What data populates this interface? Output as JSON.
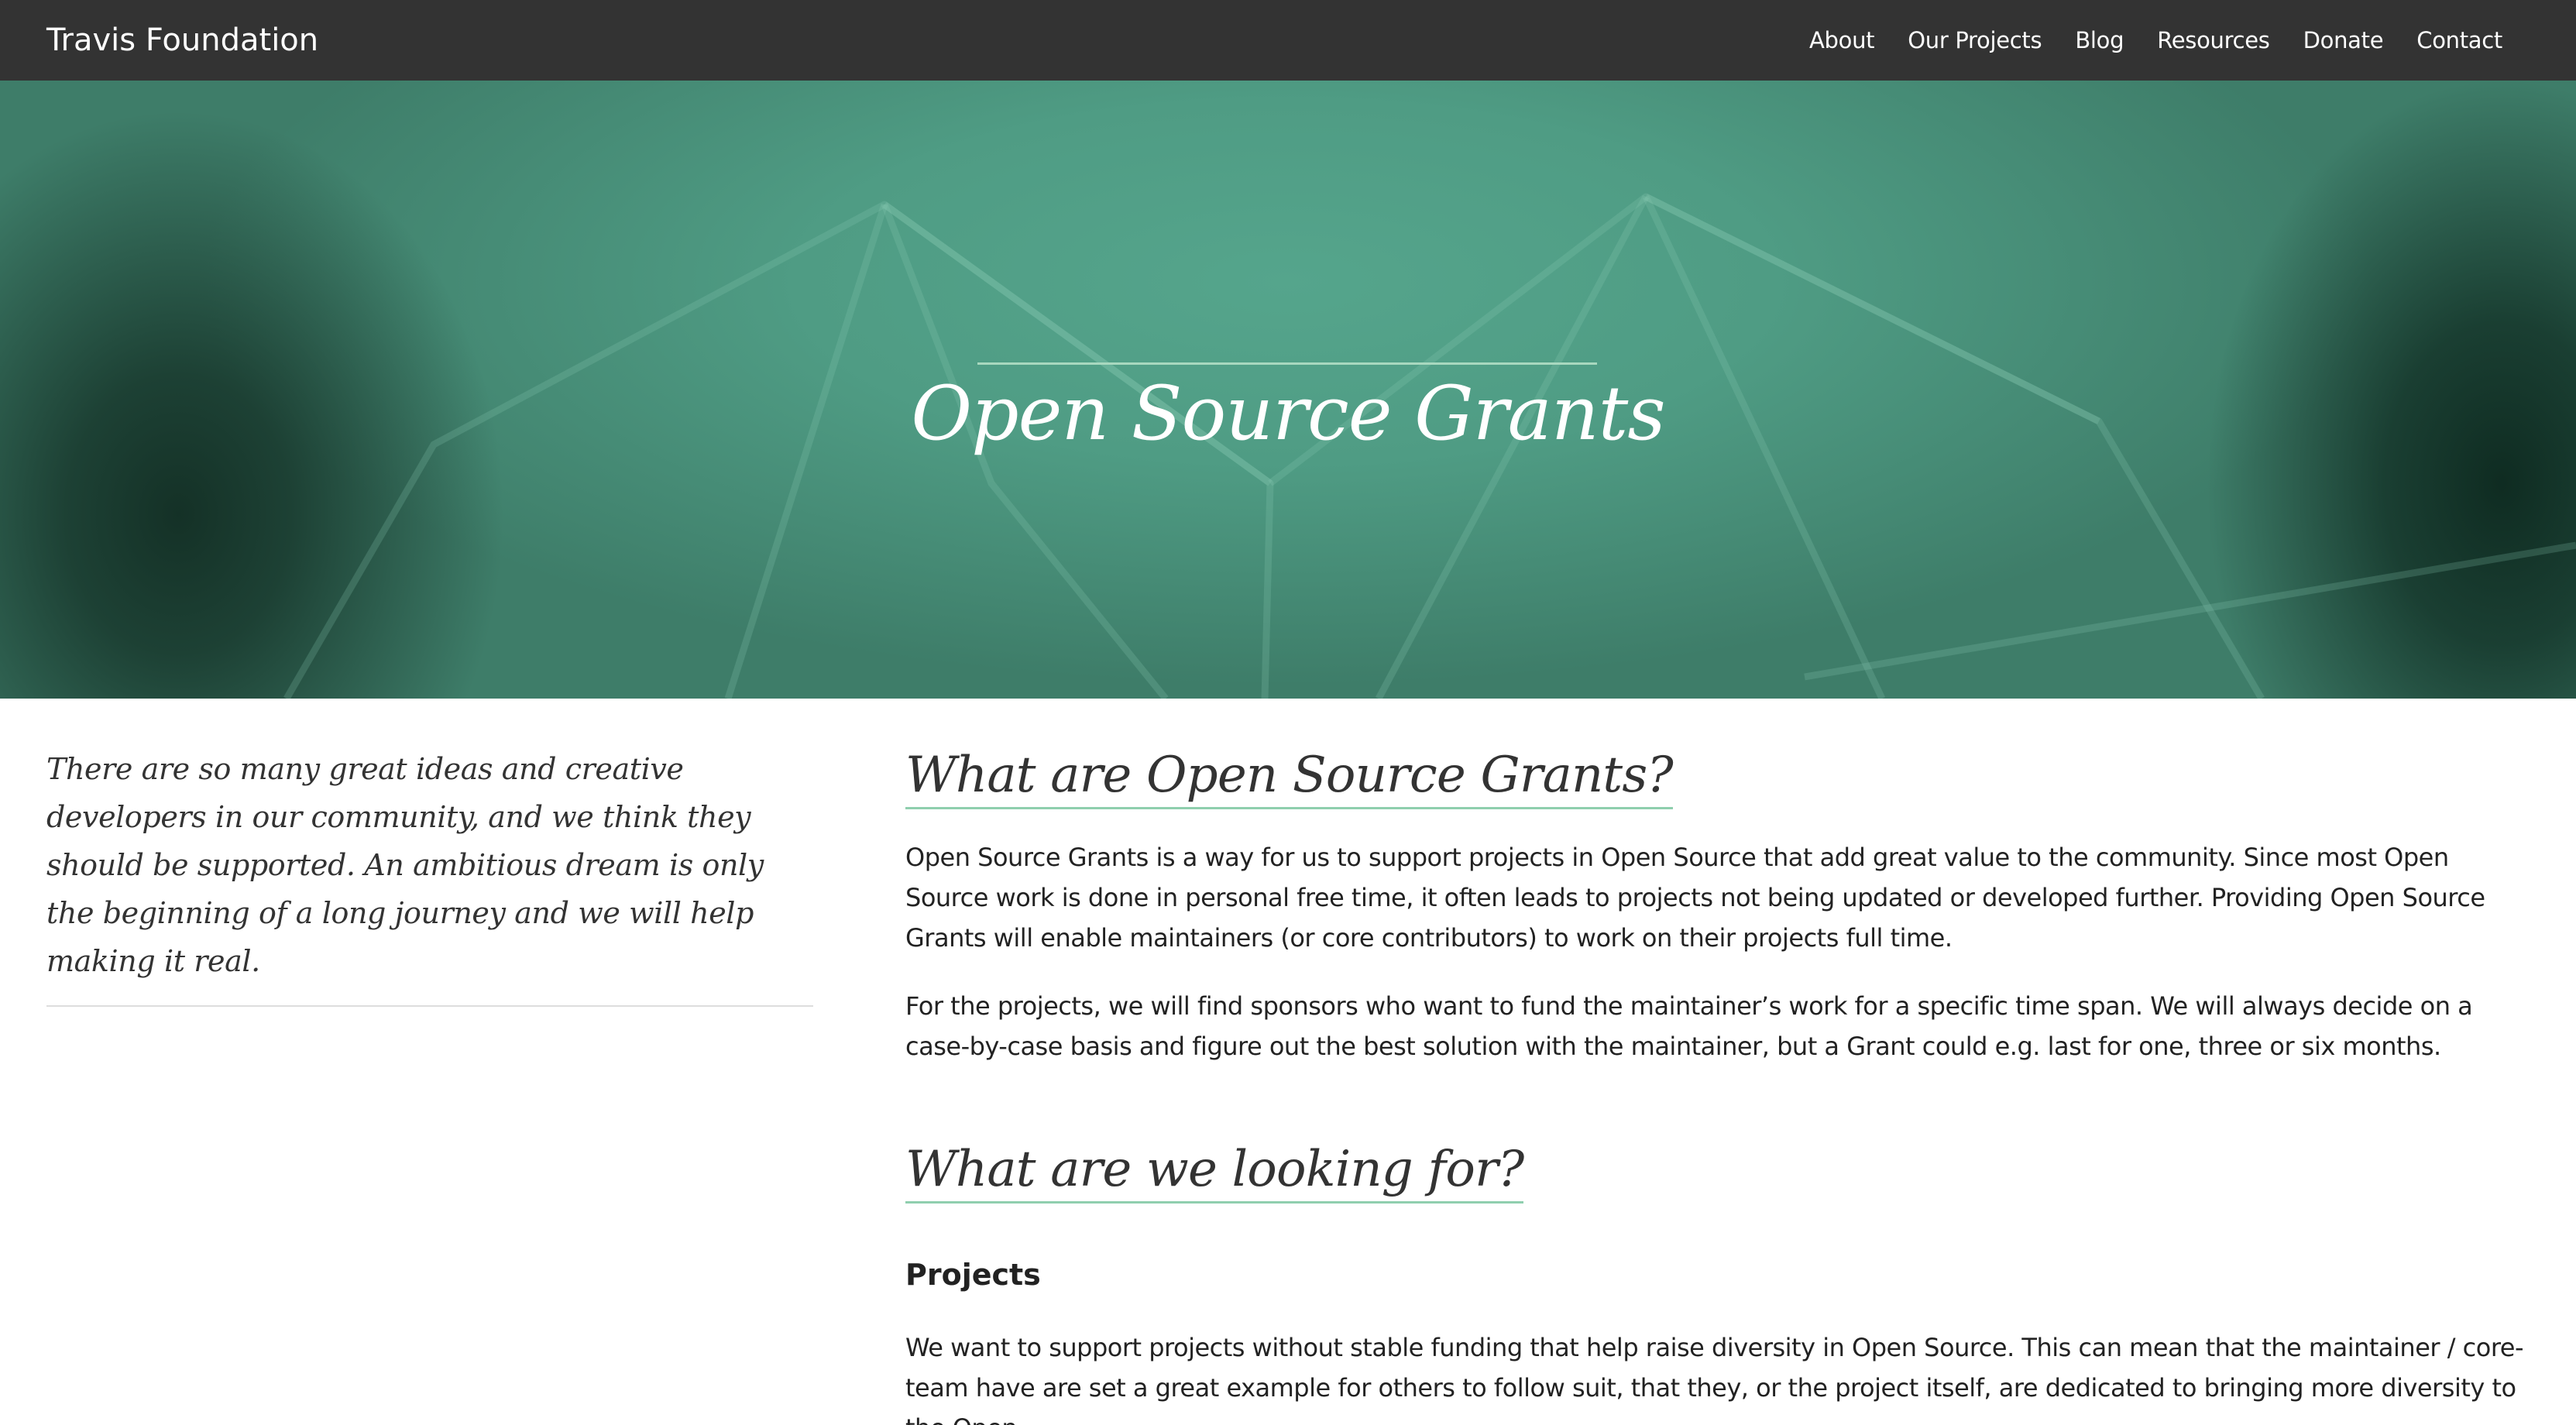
{
  "nav": {
    "brand": "Travis Foundation",
    "links": [
      "About",
      "Our Projects",
      "Blog",
      "Resources",
      "Donate",
      "Contact"
    ]
  },
  "hero": {
    "title": "Open Source Grants"
  },
  "sidebar": {
    "quote": "There are so many great ideas and creative developers in our community, and we think they should be supported. An ambitious dream is only the beginning of a long journey and we will help making it real."
  },
  "main": {
    "section1": {
      "heading": "What are Open Source Grants?",
      "paragraphs": [
        "Open Source Grants is a way for us to support projects in Open Source that add great value to the community. Since most Open Source work is done in personal free time, it often leads to projects not being updated or developed further. Providing Open Source Grants will enable maintainers (or core contributors) to work on their projects full time.",
        "For the projects, we will find sponsors who want to fund the maintainer’s work for a specific time span. We will always decide on a case-by-case basis and figure out the best solution with the maintainer, but a Grant could e.g. last for one, three or six months."
      ]
    },
    "section2": {
      "heading": "What are we looking for?",
      "subheading": "Projects",
      "paragraph": "We want to support projects without stable funding that help raise diversity in Open Source. This can mean that the maintainer / core-team have are set a great example for others to follow suit, that they, or the project itself, are dedicated to bringing more diversity to the Open"
    }
  },
  "colors": {
    "navbar_bg": "#333333",
    "hero_green": "#4f9c84",
    "accent_underline": "#8fcfae"
  }
}
